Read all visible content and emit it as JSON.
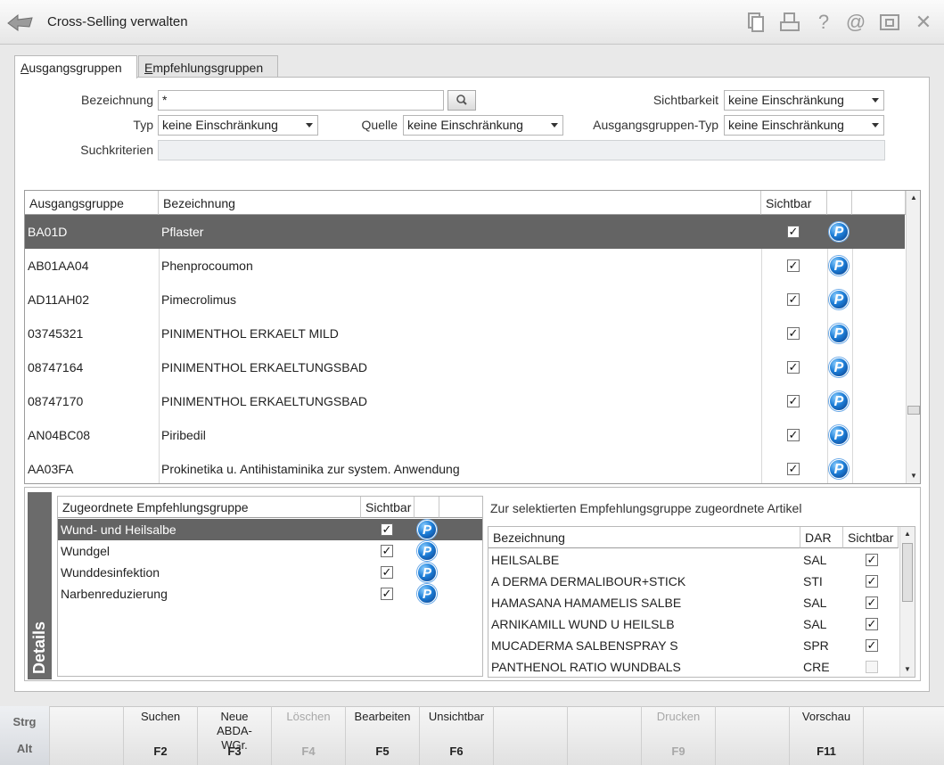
{
  "window": {
    "title": "Cross-Selling verwalten"
  },
  "titlebar_icons": [
    {
      "name": "copy-icon",
      "glyph": "▯"
    },
    {
      "name": "print-icon",
      "glyph": "⎙"
    },
    {
      "name": "help-icon",
      "glyph": "?"
    },
    {
      "name": "email-icon",
      "glyph": "@"
    },
    {
      "name": "window-icon",
      "glyph": "⊡"
    },
    {
      "name": "close-icon",
      "glyph": "✕"
    }
  ],
  "tabs": {
    "ausgang_underline": "A",
    "ausgang_rest": "usgangsgruppen",
    "empf_underline": "E",
    "empf_rest": "mpfehlungsgruppen"
  },
  "filters": {
    "bezeichnung_label": "Bezeichnung",
    "bezeichnung_value": "*",
    "typ_label": "Typ",
    "typ_value": "keine Einschränkung",
    "quelle_label": "Quelle",
    "quelle_value": "keine Einschränkung",
    "sichtbarkeit_label": "Sichtbarkeit",
    "sichtbarkeit_value": "keine Einschränkung",
    "ausgangsgruppen_typ_label": "Ausgangsgruppen-Typ",
    "ausgangsgruppen_typ_value": "keine Einschränkung",
    "suchkriterien_label": "Suchkriterien",
    "suchkriterien_value": ""
  },
  "main_table": {
    "columns": [
      "Ausgangsgruppe",
      "Bezeichnung",
      "Sichtbar"
    ],
    "rows": [
      {
        "code": "BA01D",
        "name": "Pflaster",
        "visible": true
      },
      {
        "code": "AB01AA04",
        "name": "Phenprocoumon",
        "visible": true
      },
      {
        "code": "AD11AH02",
        "name": "Pimecrolimus",
        "visible": true
      },
      {
        "code": "03745321",
        "name": "PINIMENTHOL ERKAELT MILD",
        "visible": true
      },
      {
        "code": "08747164",
        "name": "PINIMENTHOL ERKAELTUNGSBAD",
        "visible": true
      },
      {
        "code": "08747170",
        "name": "PINIMENTHOL ERKAELTUNGSBAD",
        "visible": true
      },
      {
        "code": "AN04BC08",
        "name": "Piribedil",
        "visible": true
      },
      {
        "code": "AA03FA",
        "name": "Prokinetika u. Antihistaminika zur system. Anwendung",
        "visible": true
      }
    ]
  },
  "details": {
    "label": "Details",
    "left_columns": [
      "Zugeordnete Empfehlungsgruppe",
      "Sichtbar"
    ],
    "left_rows": [
      {
        "name": "Wund- und Heilsalbe",
        "visible": true
      },
      {
        "name": "Wundgel",
        "visible": true
      },
      {
        "name": "Wunddesinfektion",
        "visible": true
      },
      {
        "name": "Narbenreduzierung",
        "visible": true
      }
    ],
    "right_title": "Zur selektierten Empfehlungsgruppe zugeordnete Artikel",
    "right_columns": [
      "Bezeichnung",
      "DAR",
      "Sichtbar"
    ],
    "right_rows": [
      {
        "name": "HEILSALBE",
        "dar": "SAL",
        "visible": true
      },
      {
        "name": "A DERMA DERMALIBOUR+STICK",
        "dar": "STI",
        "visible": true
      },
      {
        "name": "HAMASANA HAMAMELIS SALBE",
        "dar": "SAL",
        "visible": true
      },
      {
        "name": "ARNIKAMILL WUND U HEILSLB",
        "dar": "SAL",
        "visible": true
      },
      {
        "name": "MUCADERMA SALBENSPRAY S",
        "dar": "SPR",
        "visible": true
      },
      {
        "name": "PANTHENOL RATIO WUNDBALS",
        "dar": "CRE",
        "visible": false
      }
    ]
  },
  "bottom": {
    "strg": "Strg",
    "alt": "Alt",
    "keys": [
      {
        "label": "",
        "key": "",
        "enabled": true
      },
      {
        "label": "Suchen",
        "key": "F2",
        "enabled": true
      },
      {
        "label": "Neue ABDA-WGr.",
        "key": "F3",
        "enabled": true
      },
      {
        "label": "Löschen",
        "key": "F4",
        "enabled": false
      },
      {
        "label": "Bearbeiten",
        "key": "F5",
        "enabled": true
      },
      {
        "label": "Unsichtbar",
        "key": "F6",
        "enabled": true
      },
      {
        "label": "",
        "key": "",
        "enabled": true
      },
      {
        "label": "",
        "key": "",
        "enabled": true
      },
      {
        "label": "Drucken",
        "key": "F9",
        "enabled": false
      },
      {
        "label": "",
        "key": "",
        "enabled": true
      },
      {
        "label": "Vorschau",
        "key": "F11",
        "enabled": true
      },
      {
        "label": "",
        "key": "",
        "enabled": true
      }
    ]
  },
  "colors": {
    "selected_row": "#646464",
    "details_strip": "#6b6b6b"
  }
}
